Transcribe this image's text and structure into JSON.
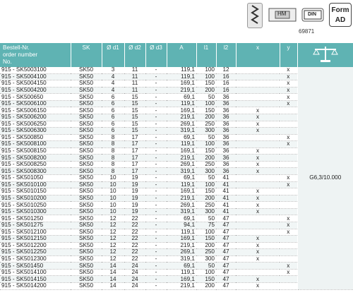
{
  "icons": {
    "hm_label": "HM",
    "din_label": "DIN",
    "din_number": "69871",
    "form_line1": "Form",
    "form_line2": "AD"
  },
  "headers": {
    "order": [
      "Bestell-Nr.",
      "order number",
      "No."
    ],
    "sk": "SK",
    "d1": "Ø d1",
    "d2": "Ø d2",
    "d3": "Ø d3",
    "a": "A",
    "l1": "l1",
    "l2": "l2",
    "x": "x",
    "y": "y"
  },
  "tolerance": "G6,3/10.000",
  "rows": [
    [
      "915 - SK5003100",
      "SK50",
      "3",
      "11",
      "-",
      "119,1",
      "100",
      "12",
      "",
      "x"
    ],
    [
      "915 - SK5004100",
      "SK50",
      "4",
      "11",
      "-",
      "119,1",
      "100",
      "16",
      "",
      "x"
    ],
    [
      "915 - SK5004150",
      "SK50",
      "4",
      "11",
      "-",
      "169,1",
      "150",
      "16",
      "",
      "x"
    ],
    [
      "915 - SK5004200",
      "SK50",
      "4",
      "11",
      "-",
      "219,1",
      "200",
      "16",
      "",
      "x"
    ],
    [
      "915 - SK500650",
      "SK50",
      "6",
      "15",
      "-",
      "69,1",
      "50",
      "36",
      "",
      "x"
    ],
    [
      "915 - SK5006100",
      "SK50",
      "6",
      "15",
      "-",
      "119,1",
      "100",
      "36",
      "",
      "x"
    ],
    [
      "915 - SK5006150",
      "SK50",
      "6",
      "15",
      "-",
      "169,1",
      "150",
      "36",
      "x",
      ""
    ],
    [
      "915 - SK5006200",
      "SK50",
      "6",
      "15",
      "-",
      "219,1",
      "200",
      "36",
      "x",
      ""
    ],
    [
      "915 - SK5006250",
      "SK50",
      "6",
      "15",
      "-",
      "269,1",
      "250",
      "36",
      "x",
      ""
    ],
    [
      "915 - SK5006300",
      "SK50",
      "6",
      "15",
      "-",
      "319,1",
      "300",
      "36",
      "x",
      ""
    ],
    [
      "915 - SK500850",
      "SK50",
      "8",
      "17",
      "-",
      "69,1",
      "50",
      "36",
      "",
      "x"
    ],
    [
      "915 - SK5008100",
      "SK50",
      "8",
      "17",
      "-",
      "119,1",
      "100",
      "36",
      "",
      "x"
    ],
    [
      "915 - SK5008150",
      "SK50",
      "8",
      "17",
      "-",
      "169,1",
      "150",
      "36",
      "x",
      ""
    ],
    [
      "915 - SK5008200",
      "SK50",
      "8",
      "17",
      "-",
      "219,1",
      "200",
      "36",
      "x",
      ""
    ],
    [
      "915 - SK5008250",
      "SK50",
      "8",
      "17",
      "-",
      "269,1",
      "250",
      "36",
      "x",
      ""
    ],
    [
      "915 - SK5008300",
      "SK50",
      "8",
      "17",
      "-",
      "319,1",
      "300",
      "36",
      "x",
      ""
    ],
    [
      "915 - SK501050",
      "SK50",
      "10",
      "19",
      "-",
      "69,1",
      "50",
      "41",
      "",
      "x"
    ],
    [
      "915 - SK5010100",
      "SK50",
      "10",
      "19",
      "-",
      "119,1",
      "100",
      "41",
      "",
      "x"
    ],
    [
      "915 - SK5010150",
      "SK50",
      "10",
      "19",
      "-",
      "169,1",
      "150",
      "41",
      "x",
      ""
    ],
    [
      "915 - SK5010200",
      "SK50",
      "10",
      "19",
      "-",
      "219,1",
      "200",
      "41",
      "x",
      ""
    ],
    [
      "915 - SK5010250",
      "SK50",
      "10",
      "19",
      "-",
      "269,1",
      "250",
      "41",
      "x",
      ""
    ],
    [
      "915 - SK5010300",
      "SK50",
      "10",
      "19",
      "-",
      "319,1",
      "300",
      "41",
      "x",
      ""
    ],
    [
      "915 - SK501250",
      "SK50",
      "12",
      "22",
      "-",
      "69,1",
      "50",
      "47",
      "",
      "x"
    ],
    [
      "915 - SK501275",
      "SK50",
      "12",
      "22",
      "-",
      "94,1",
      "75",
      "47",
      "",
      "x"
    ],
    [
      "915 - SK5012100",
      "SK50",
      "12",
      "22",
      "-",
      "119,1",
      "100",
      "47",
      "",
      "x"
    ],
    [
      "915 - SK5012150",
      "SK50",
      "12",
      "22",
      "-",
      "169,1",
      "150",
      "47",
      "x",
      ""
    ],
    [
      "915 - SK5012200",
      "SK50",
      "12",
      "22",
      "-",
      "219,1",
      "200",
      "47",
      "x",
      ""
    ],
    [
      "915 - SK5012250",
      "SK50",
      "12",
      "22",
      "-",
      "269,1",
      "250",
      "47",
      "x",
      ""
    ],
    [
      "915 - SK5012300",
      "SK50",
      "12",
      "22",
      "-",
      "319,1",
      "300",
      "47",
      "x",
      ""
    ],
    [
      "915 - SK501450",
      "SK50",
      "14",
      "24",
      "-",
      "69,1",
      "50",
      "47",
      "",
      "x"
    ],
    [
      "915 - SK5014100",
      "SK50",
      "14",
      "24",
      "-",
      "119,1",
      "100",
      "47",
      "",
      "x"
    ],
    [
      "915 - SK5014150",
      "SK50",
      "14",
      "24",
      "-",
      "169,1",
      "150",
      "47",
      "x",
      ""
    ],
    [
      "915 - SK5014200",
      "SK50",
      "14",
      "24",
      "-",
      "219,1",
      "200",
      "47",
      "x",
      ""
    ]
  ]
}
